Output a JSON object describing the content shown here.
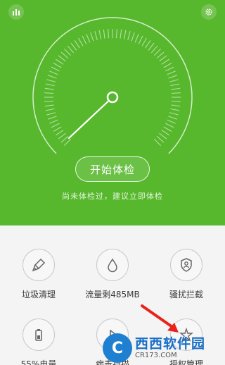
{
  "header": {
    "stats_icon": "bar-chart-icon",
    "settings_icon": "gear-icon"
  },
  "gauge": {
    "needle_icon": "gauge-needle"
  },
  "start_button": {
    "label": "开始体检"
  },
  "hint": "尚未体检过，建议立即体检",
  "tools": [
    {
      "label": "垃圾清理",
      "icon": "broom-icon"
    },
    {
      "label": "流量剩485MB",
      "icon": "drop-icon"
    },
    {
      "label": "骚扰拦截",
      "icon": "shield-user-icon"
    },
    {
      "label": "55%电量",
      "icon": "battery-icon"
    },
    {
      "label": "病毒扫描",
      "icon": "virus-scan-icon"
    },
    {
      "label": "授权管理",
      "icon": "authorization-icon"
    }
  ],
  "watermark": {
    "main": "西西软件园",
    "sub": "CR173.COM"
  },
  "colors": {
    "accent": "#57b82d",
    "annotation_arrow": "#e8231c"
  }
}
